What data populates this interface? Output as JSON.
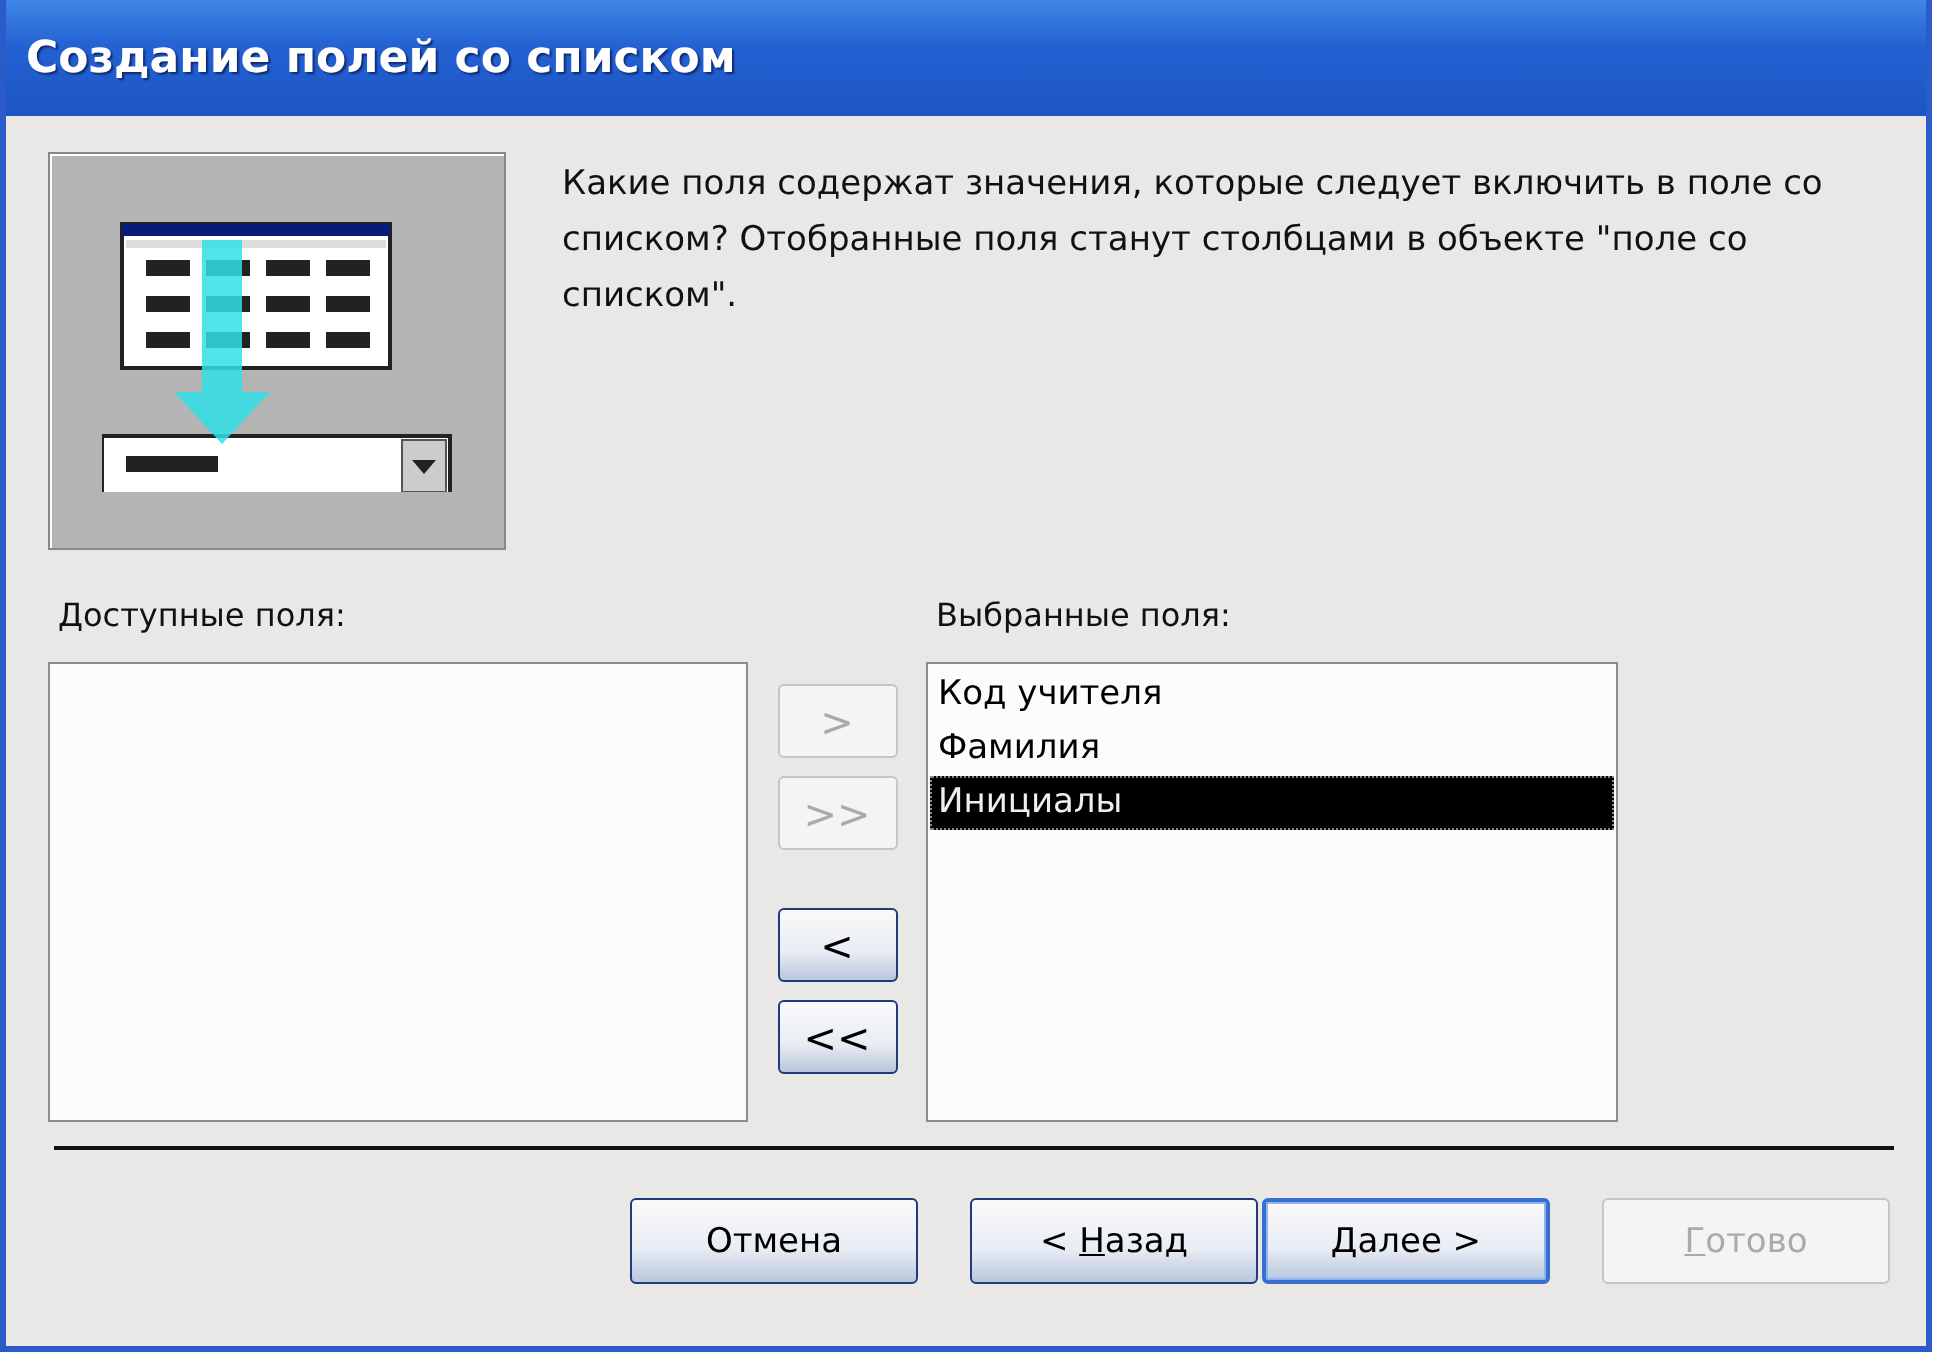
{
  "window": {
    "title": "Создание полей со списком"
  },
  "prompt": "Какие поля содержат значения, которые следует включить в поле со списком? Отобранные поля станут столбцами в объекте \"поле со списком\".",
  "available": {
    "label": "Доступные поля:"
  },
  "selected_fields": {
    "label": "Выбранные поля:",
    "items": [
      {
        "text": "Код учителя",
        "selected": false
      },
      {
        "text": "Фамилия",
        "selected": false
      },
      {
        "text": "Инициалы",
        "selected": true
      }
    ]
  },
  "move_buttons": [
    {
      "label": ">",
      "disabled": true
    },
    {
      "label": ">>",
      "disabled": true
    },
    {
      "label": "<",
      "disabled": false
    },
    {
      "label": "<<",
      "disabled": false
    }
  ],
  "buttons": [
    {
      "label_parts": [
        "Отмена"
      ],
      "disabled": false,
      "default": false
    },
    {
      "label_parts": [
        "< ",
        "Н",
        "азад"
      ],
      "disabled": false,
      "default": false
    },
    {
      "label_parts": [
        "Д",
        "алее >"
      ],
      "disabled": false,
      "default": true
    },
    {
      "label_parts": [
        "Г",
        "отово"
      ],
      "disabled": true,
      "default": false
    }
  ]
}
